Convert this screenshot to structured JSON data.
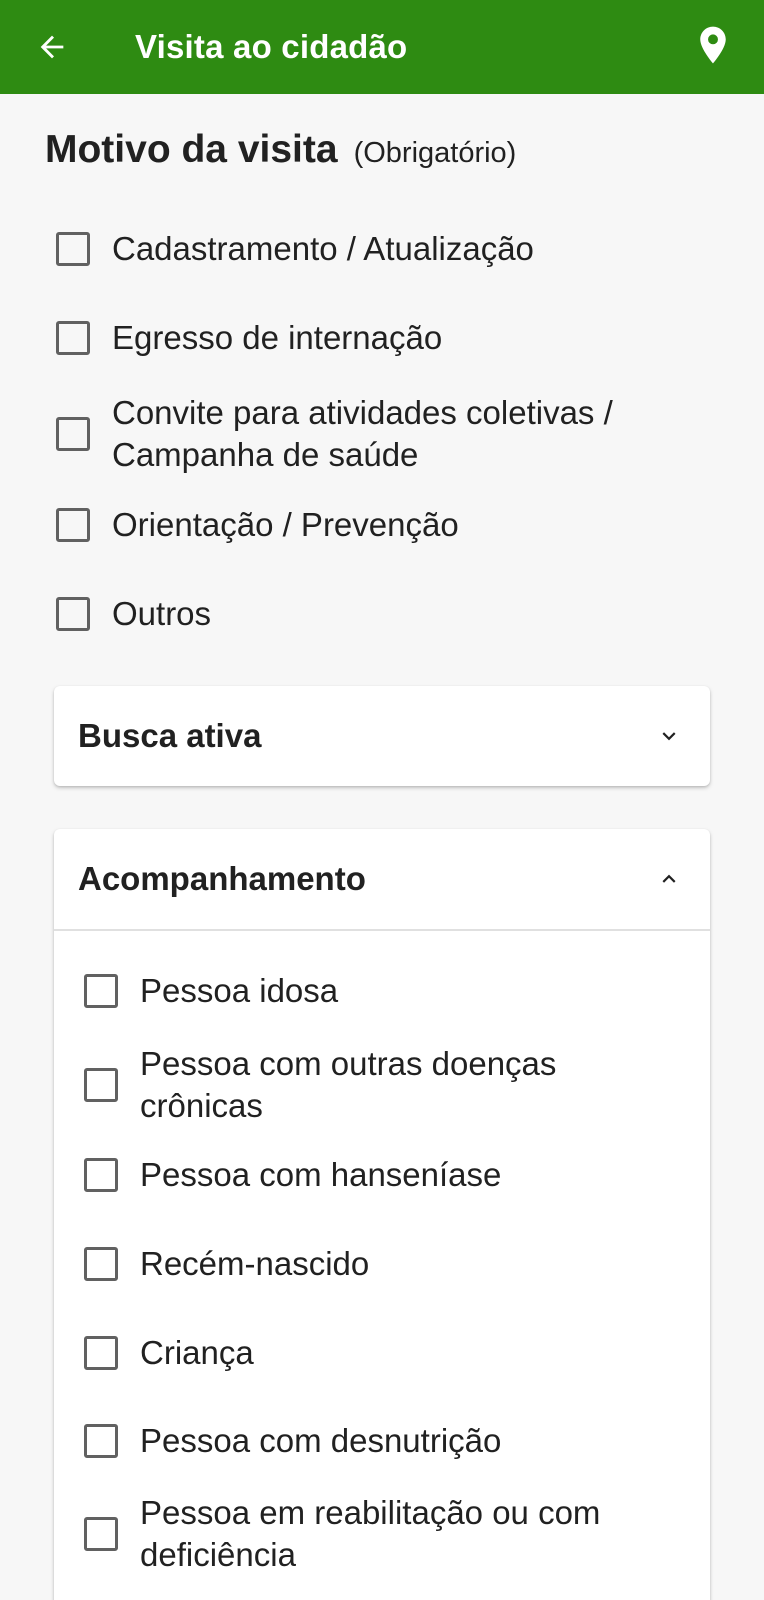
{
  "appbar": {
    "title": "Visita ao cidadão",
    "back_icon": "arrow-left-icon",
    "location_icon": "map-pin-icon",
    "color": "#2e8b12"
  },
  "motivo": {
    "title": "Motivo da visita",
    "required": "(Obrigatório)",
    "items": [
      {
        "label": "Cadastramento / Atualização",
        "checked": false
      },
      {
        "label": "Egresso de internação",
        "checked": false
      },
      {
        "label": "Convite para atividades coletivas / Campanha de saúde",
        "checked": false
      },
      {
        "label": "Orientação / Prevenção",
        "checked": false
      },
      {
        "label": "Outros",
        "checked": false
      }
    ]
  },
  "busca_ativa": {
    "title": "Busca ativa",
    "expanded": false,
    "icon": "chevron-down-icon"
  },
  "acompanhamento": {
    "title": "Acompanhamento",
    "expanded": true,
    "icon": "chevron-up-icon",
    "items": [
      {
        "label": "Pessoa idosa",
        "checked": false
      },
      {
        "label": "Pessoa com outras doenças crônicas",
        "checked": false
      },
      {
        "label": "Pessoa com hanseníase",
        "checked": false
      },
      {
        "label": "Recém-nascido",
        "checked": false
      },
      {
        "label": "Criança",
        "checked": false
      },
      {
        "label": "Pessoa com desnutrição",
        "checked": false
      },
      {
        "label": "Pessoa em reabilitação ou com deficiência",
        "checked": false
      }
    ]
  }
}
